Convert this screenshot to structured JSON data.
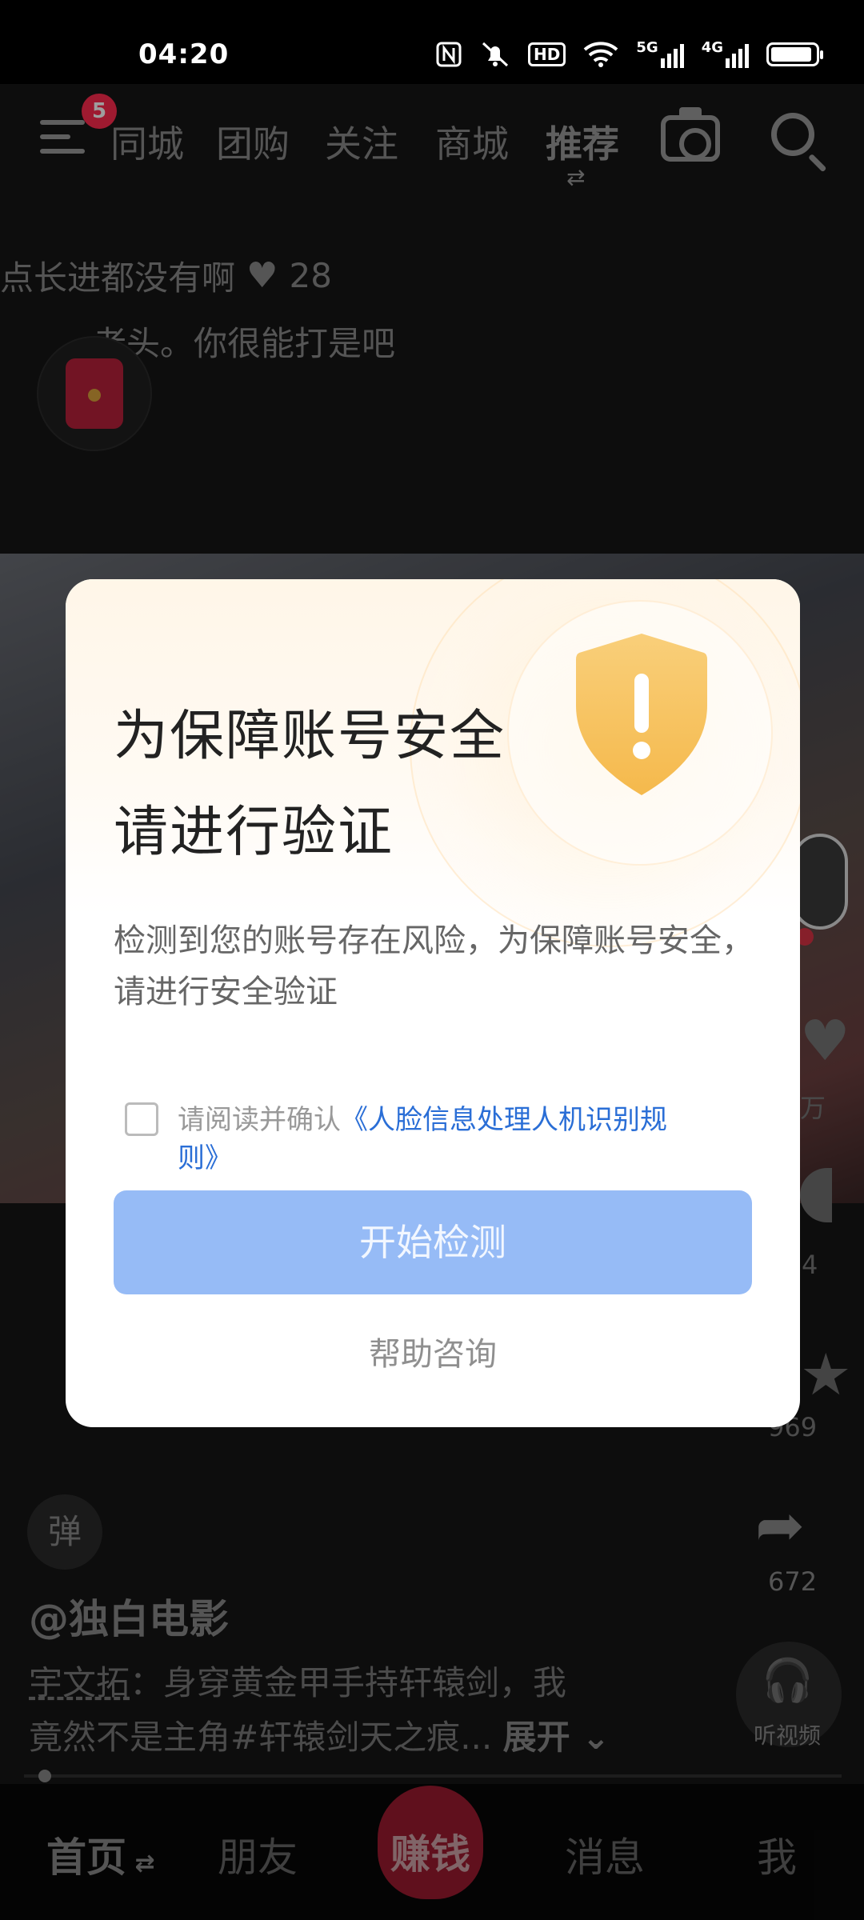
{
  "status_bar": {
    "time": "04:20",
    "icons": [
      "nfc-icon",
      "mute-icon",
      "hd-icon",
      "wifi-icon",
      "5g-signal-icon",
      "4g-signal-icon",
      "battery-icon"
    ],
    "hd_label": "HD",
    "net1": "5G",
    "net2": "4G"
  },
  "top_nav": {
    "menu_badge": "5",
    "tabs": [
      "同城",
      "团购",
      "关注",
      "商城",
      "推荐"
    ],
    "active_tab": "推荐",
    "swap_glyph": "⇄"
  },
  "feed": {
    "comment1_text": "点长进都没有啊",
    "comment1_likes": "28",
    "comment2_text": "老头。你很能打是吧",
    "like_count": "万",
    "comment_count": "4",
    "star_count": "969",
    "share_count": "672",
    "listen_label": "听视频",
    "danmu_label": "弹",
    "author": "@独白电影",
    "desc_name": "宇文拓",
    "desc_line1_rest": "：身穿黄金甲手持轩辕剑，我",
    "desc_line2": "竟然不是主角#轩辕剑天之痕...",
    "expand_label": "展开",
    "playback_progress": 0.02
  },
  "bottom_nav": {
    "home": "首页",
    "friends": "朋友",
    "earn": "赚钱",
    "messages": "消息",
    "me": "我"
  },
  "dialog": {
    "title_line1": "为保障账号安全",
    "title_line2": "请进行验证",
    "body": "检测到您的账号存在风险，为保障账号安全，请进行安全验证",
    "consent_prefix": "请阅读并确认",
    "consent_link": "《人脸信息处理人机识别规则》",
    "start_button": "开始检测",
    "help_link": "帮助咨询",
    "checkbox_checked": false,
    "colors": {
      "primary_button": "#96bbf6",
      "link": "#2a6ed6",
      "shield": "#f7c56a"
    }
  }
}
